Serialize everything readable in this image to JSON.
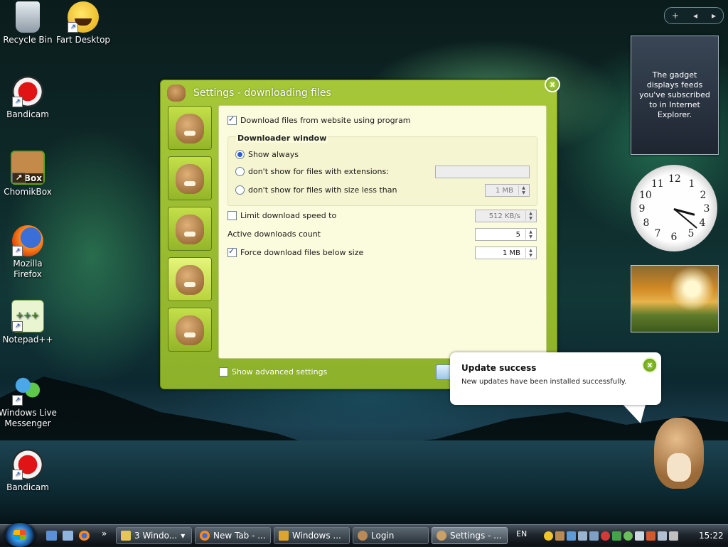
{
  "desktop": {
    "icons": [
      {
        "label": "Recycle Bin",
        "icon": "recycle-bin-icon"
      },
      {
        "label": "Fart Desktop",
        "icon": "smiley-icon"
      },
      {
        "label": "Bandicam",
        "icon": "bandicam-icon"
      },
      {
        "label": "ChomikBox",
        "icon": "chomikbox-icon",
        "badge": "Box"
      },
      {
        "label": "Mozilla Firefox",
        "label_lines": [
          "Mozilla",
          "Firefox"
        ],
        "icon": "firefox-icon"
      },
      {
        "label": "Notepad++",
        "icon": "notepad-plus-plus-icon"
      },
      {
        "label": "Windows Live Messenger",
        "label_lines": [
          "Windows Live",
          "Messenger"
        ],
        "icon": "messenger-icon"
      },
      {
        "label": "Bandicam",
        "icon": "bandicam-icon"
      }
    ]
  },
  "gadgets": {
    "bar": {
      "add": "+",
      "prev": "◂",
      "next": "▸"
    },
    "feed_text": "The gadget displays feeds you've subscribed to in Internet Explorer.",
    "clock_numbers": [
      "12",
      "1",
      "2",
      "3",
      "4",
      "5",
      "6",
      "7",
      "8",
      "9",
      "10",
      "11"
    ]
  },
  "settings_window": {
    "title": "Settings - downloading files",
    "close": "x",
    "download_via_program": {
      "label": "Download files from website using program",
      "checked": true
    },
    "downloader_group_title": "Downloader window",
    "radio_show_always": {
      "label": "Show always",
      "selected": true
    },
    "radio_extensions": {
      "label": "don't show for files with extensions:",
      "selected": false,
      "value": ""
    },
    "radio_size": {
      "label": "don't show for files with size less than",
      "selected": false,
      "value": "1 MB"
    },
    "limit_speed": {
      "label": "Limit download speed to",
      "checked": false,
      "value": "512 KB/s"
    },
    "active_downloads": {
      "label": "Active downloads count",
      "value": "5"
    },
    "force_download": {
      "label": "Force download files below size",
      "checked": true,
      "value": "1 MB"
    },
    "advanced": {
      "label": "Show advanced settings",
      "checked": false
    }
  },
  "notification": {
    "title": "Update success",
    "message": "New updates have been installed successfully.",
    "close": "x"
  },
  "taskbar": {
    "buttons": [
      {
        "label": "3 Windo...",
        "icon": "folder-icon",
        "dropdown": "▾"
      },
      {
        "label": "New Tab - ...",
        "icon": "firefox-icon"
      },
      {
        "label": "Windows ...",
        "icon": "media-icon"
      },
      {
        "label": "Login",
        "icon": "chomik-icon"
      },
      {
        "label": "Settings - ...",
        "icon": "settings-icon",
        "active": true
      }
    ],
    "overflow": "»",
    "language": "EN",
    "time": "15:22"
  },
  "colors": {
    "window_green": "#9bbf30",
    "panel_bg": "#fbfbdd",
    "checkbox_blue": "#2b5bcc"
  }
}
